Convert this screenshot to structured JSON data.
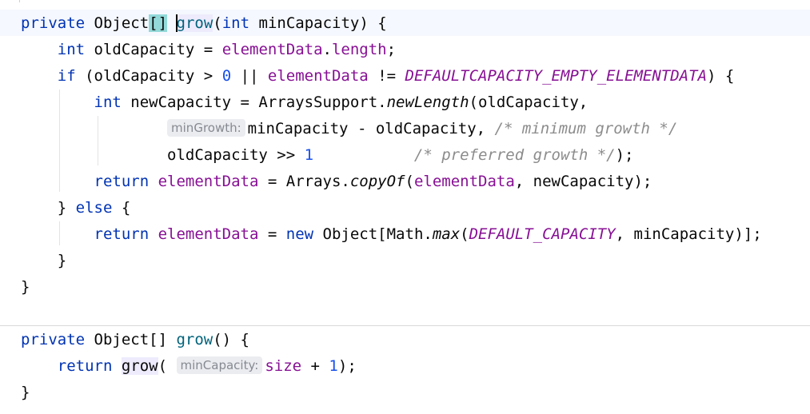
{
  "editor": {
    "lines": [
      {
        "tokens": [
          {
            "t": "private",
            "c": "kw"
          },
          {
            "t": " "
          },
          {
            "t": "Object"
          },
          {
            "t": "[]",
            "c": "bracematch"
          },
          {
            "t": " "
          },
          {
            "caret": true
          },
          {
            "t": "grow",
            "c": "meth usage"
          },
          {
            "t": "("
          },
          {
            "t": "int",
            "c": "kw"
          },
          {
            "t": " minCapacity) {"
          }
        ]
      },
      {
        "tokens": [
          {
            "t": "    "
          },
          {
            "t": "int",
            "c": "kw"
          },
          {
            "t": " oldCapacity = "
          },
          {
            "t": "elementData",
            "c": "fld"
          },
          {
            "t": "."
          },
          {
            "t": "length",
            "c": "fld"
          },
          {
            "t": ";"
          }
        ]
      },
      {
        "tokens": [
          {
            "t": "    "
          },
          {
            "t": "if",
            "c": "kw"
          },
          {
            "t": " (oldCapacity > "
          },
          {
            "t": "0",
            "c": "num"
          },
          {
            "t": " || "
          },
          {
            "t": "elementData",
            "c": "fld"
          },
          {
            "t": " != "
          },
          {
            "t": "DEFAULTCAPACITY_EMPTY_ELEMENTDATA",
            "c": "const"
          },
          {
            "t": ") {"
          }
        ]
      },
      {
        "tokens": [
          {
            "t": "        "
          },
          {
            "t": "int",
            "c": "kw"
          },
          {
            "t": " newCapacity = ArraysSupport."
          },
          {
            "t": "newLength",
            "c": "st"
          },
          {
            "t": "(oldCapacity,"
          }
        ]
      },
      {
        "tokens": [
          {
            "t": "                "
          },
          {
            "hint": "minGrowth:"
          },
          {
            "t": "minCapacity - oldCapacity, "
          },
          {
            "t": "/* minimum growth */",
            "c": "cmt"
          }
        ]
      },
      {
        "tokens": [
          {
            "t": "                "
          },
          {
            "t": "oldCapacity >> "
          },
          {
            "t": "1",
            "c": "num"
          },
          {
            "t": "           "
          },
          {
            "t": "/* preferred growth */",
            "c": "cmt"
          },
          {
            "t": ");"
          }
        ]
      },
      {
        "tokens": [
          {
            "t": "        "
          },
          {
            "t": "return",
            "c": "kw"
          },
          {
            "t": " "
          },
          {
            "t": "elementData",
            "c": "fld"
          },
          {
            "t": " = Arrays."
          },
          {
            "t": "copyOf",
            "c": "st"
          },
          {
            "t": "("
          },
          {
            "t": "elementData",
            "c": "fld"
          },
          {
            "t": ", newCapacity);"
          }
        ]
      },
      {
        "tokens": [
          {
            "t": "    } "
          },
          {
            "t": "else",
            "c": "kw"
          },
          {
            "t": " {"
          }
        ]
      },
      {
        "tokens": [
          {
            "t": "        "
          },
          {
            "t": "return",
            "c": "kw"
          },
          {
            "t": " "
          },
          {
            "t": "elementData",
            "c": "fld"
          },
          {
            "t": " = "
          },
          {
            "t": "new",
            "c": "kw"
          },
          {
            "t": " Object[Math."
          },
          {
            "t": "max",
            "c": "st"
          },
          {
            "t": "("
          },
          {
            "t": "DEFAULT_CAPACITY",
            "c": "const"
          },
          {
            "t": ", minCapacity)];"
          }
        ]
      },
      {
        "tokens": [
          {
            "t": "    }"
          }
        ]
      },
      {
        "tokens": [
          {
            "t": "}"
          }
        ]
      },
      {
        "tokens": []
      },
      {
        "tokens": [
          {
            "t": "private",
            "c": "kw"
          },
          {
            "t": " Object[] "
          },
          {
            "t": "grow",
            "c": "meth"
          },
          {
            "t": "() {"
          }
        ]
      },
      {
        "tokens": [
          {
            "t": "    "
          },
          {
            "t": "return",
            "c": "kw"
          },
          {
            "t": " "
          },
          {
            "t": "grow",
            "c": "usage"
          },
          {
            "t": "( "
          },
          {
            "hint": "minCapacity:"
          },
          {
            "t": "size",
            "c": "fld"
          },
          {
            "t": " + "
          },
          {
            "t": "1",
            "c": "num"
          },
          {
            "t": ");"
          }
        ]
      },
      {
        "tokens": [
          {
            "t": "}"
          }
        ]
      }
    ]
  },
  "colors": {
    "keyword": "#0033b3",
    "field": "#871094",
    "number": "#1750eb",
    "method": "#00627a",
    "comment": "#8c8c8c",
    "caret_line": "#f5f8fe",
    "brace_match": "#93d9d9",
    "usage_highlight": "#edebfc"
  }
}
